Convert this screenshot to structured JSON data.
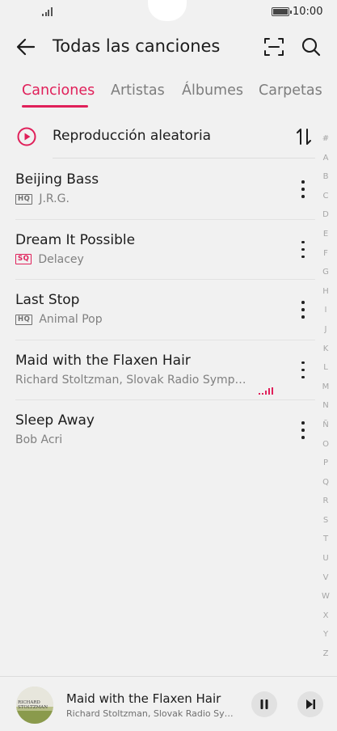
{
  "status_bar": {
    "time": "10:00"
  },
  "header": {
    "title": "Todas las canciones"
  },
  "tabs": [
    {
      "label": "Canciones",
      "active": true
    },
    {
      "label": "Artistas",
      "active": false
    },
    {
      "label": "Álbumes",
      "active": false
    },
    {
      "label": "Carpetas",
      "active": false
    }
  ],
  "shuffle": {
    "label": "Reproducción aleatoria"
  },
  "songs": [
    {
      "title": "Beijing Bass",
      "quality": "HQ",
      "artist": "J.R.G.",
      "playing": false
    },
    {
      "title": "Dream It Possible",
      "quality": "SQ",
      "artist": "Delacey",
      "playing": false
    },
    {
      "title": "Last Stop",
      "quality": "HQ",
      "artist": "Animal Pop",
      "playing": false
    },
    {
      "title": "Maid with the Flaxen Hair",
      "quality": "",
      "artist": "Richard Stoltzman, Slovak Radio Symphon…",
      "playing": true
    },
    {
      "title": "Sleep Away",
      "quality": "",
      "artist": "Bob Acri",
      "playing": false
    }
  ],
  "index_letters": [
    "#",
    "A",
    "B",
    "C",
    "D",
    "E",
    "F",
    "G",
    "H",
    "I",
    "J",
    "K",
    "L",
    "M",
    "N",
    "Ñ",
    "O",
    "P",
    "Q",
    "R",
    "S",
    "T",
    "U",
    "V",
    "W",
    "X",
    "Y",
    "Z"
  ],
  "now_playing": {
    "title": "Maid with the Flaxen Hair",
    "artist": "Richard Stoltzman, Slovak Radio Symp…",
    "cover_text": "RICHARD STOLTZMAN"
  },
  "colors": {
    "accent": "#e0205a",
    "background": "#f1f1f1",
    "text": "#1c1c1c",
    "secondary_text": "#808080"
  }
}
